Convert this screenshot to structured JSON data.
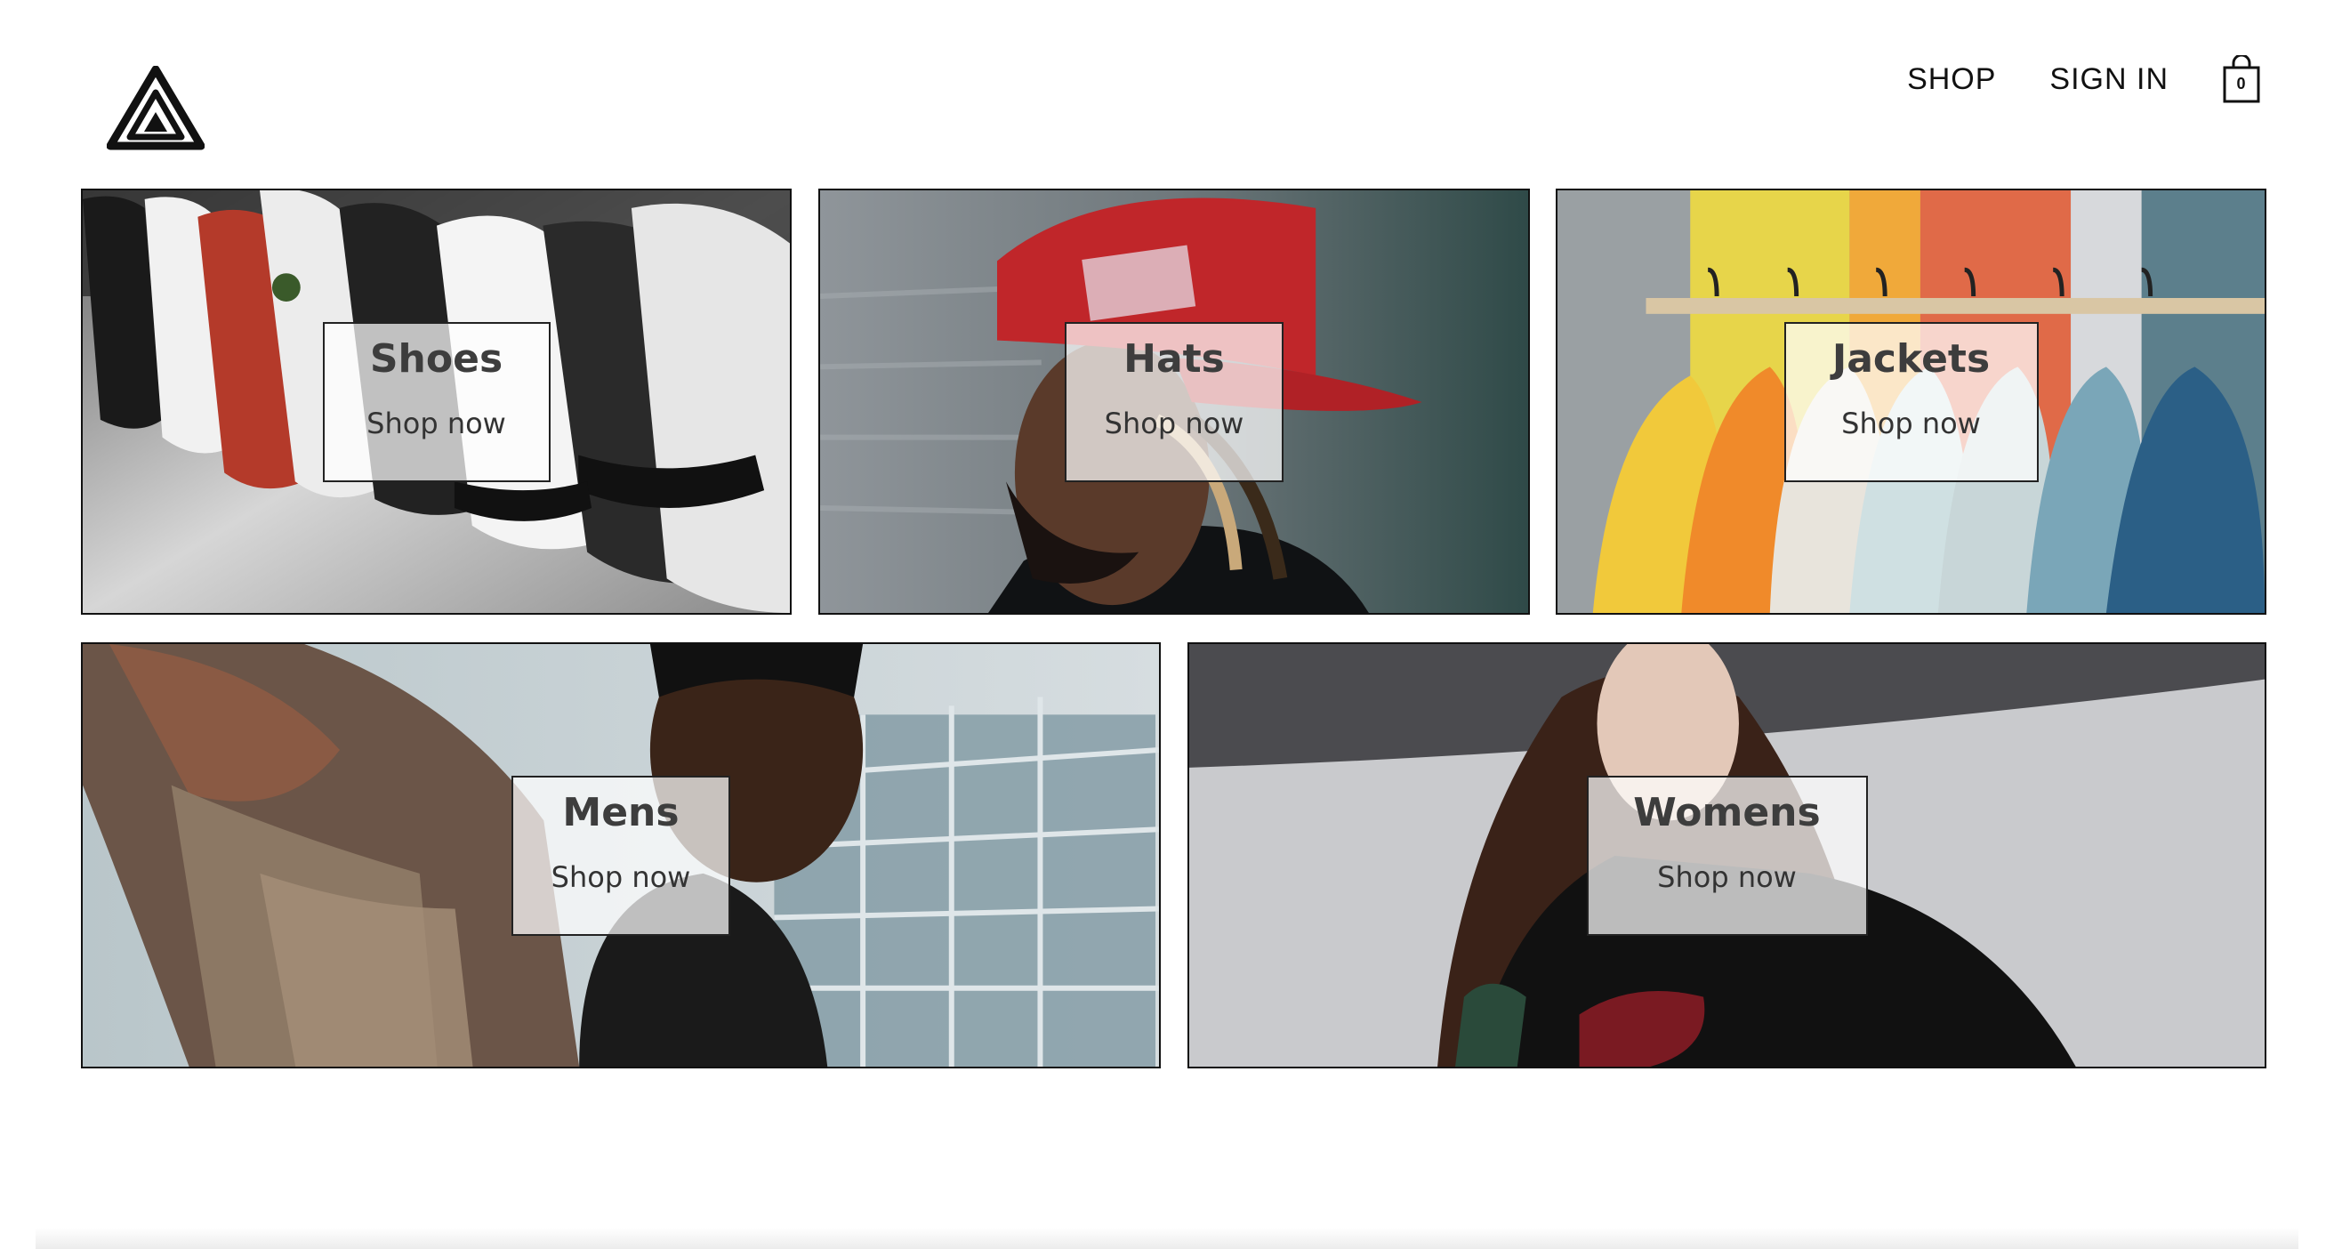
{
  "header": {
    "logo_icon": "triangle-logo-icon",
    "nav": {
      "shop": "SHOP",
      "sign_in": "SIGN IN"
    },
    "cart": {
      "icon": "shopping-bag-icon",
      "count": "0"
    }
  },
  "categories": [
    {
      "title": "Shoes",
      "cta": "Shop now",
      "icon": "sneakers-photo"
    },
    {
      "title": "Hats",
      "cta": "Shop now",
      "icon": "cap-model-photo"
    },
    {
      "title": "Jackets",
      "cta": "Shop now",
      "icon": "jacket-rack-photo"
    },
    {
      "title": "Mens",
      "cta": "Shop now",
      "icon": "mens-model-photo"
    },
    {
      "title": "Womens",
      "cta": "Shop now",
      "icon": "womens-model-photo"
    }
  ],
  "colors": {
    "border": "#111111",
    "label_bg": "rgba(255,255,255,0.72)",
    "text": "#3d3d3d"
  }
}
